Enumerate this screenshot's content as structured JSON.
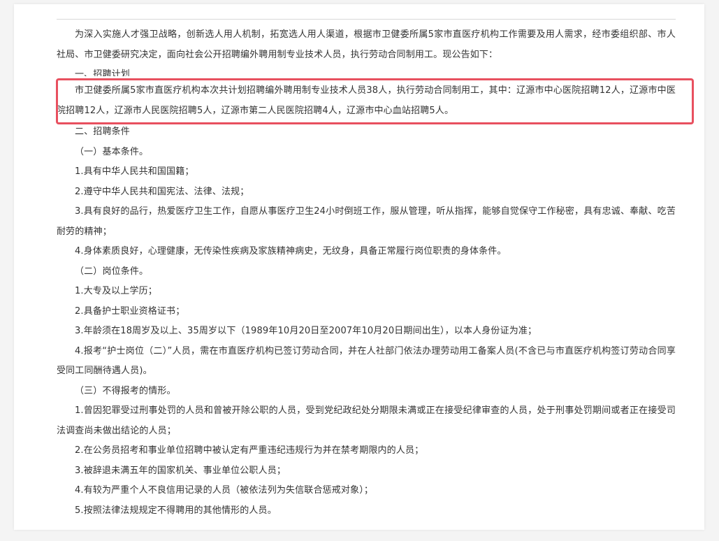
{
  "accent_color": "#e8505f",
  "article": {
    "paragraphs": [
      "为深入实施人才强卫战略，创新选人用人机制，拓宽选人用人渠道，根据市卫健委所属5家市直医疗机构工作需要及用人需求，经市委组织部、市人社局、市卫健委研究决定，面向社会公开招聘编外聘用制专业技术人员，执行劳动合同制用工。现公告如下：",
      "一、招聘计划",
      "市卫健委所属5家市直医疗机构本次共计划招聘编外聘用制专业技术人员38人，执行劳动合同制用工，其中：辽源市中心医院招聘12人，辽源市中医院招聘12人，辽源市人民医院招聘5人，辽源市第二人民医院招聘4人，辽源市中心血站招聘5人。",
      "二、招聘条件",
      "（一）基本条件。",
      "1.具有中华人民共和国国籍；",
      "2.遵守中华人民共和国宪法、法律、法规；",
      "3.具有良好的品行，热爱医疗卫生工作，自愿从事医疗卫生24小时倒班工作，服从管理，听从指挥，能够自觉保守工作秘密，具有忠诚、奉献、吃苦耐劳的精神；",
      "4.身体素质良好，心理健康，无传染性疾病及家族精神病史，无纹身，具备正常履行岗位职责的身体条件。",
      "（二）岗位条件。",
      "1.大专及以上学历；",
      "2.具备护士职业资格证书；",
      "3.年龄须在18周岁及以上、35周岁以下（1989年10月20日至2007年10月20日期间出生），以本人身份证为准；",
      "4.报考“护士岗位（二）”人员，需在市直医疗机构已签订劳动合同，并在人社部门依法办理劳动用工备案人员(不含已与市直医疗机构签订劳动合同享受同工同酬待遇人员)。",
      "（三）不得报考的情形。",
      "1.曾因犯罪受过刑事处罚的人员和曾被开除公职的人员，受到党纪政纪处分期限未满或正在接受纪律审查的人员，处于刑事处罚期间或者正在接受司法调查尚未做出结论的人员；",
      "2.在公务员招考和事业单位招聘中被认定有严重违纪违规行为并在禁考期限内的人员；",
      "3.被辞退未满五年的国家机关、事业单位公职人员；",
      "4.有较为严重个人不良信用记录的人员（被依法列为失信联合惩戒对象）；",
      "5.按照法律法规规定不得聘用的其他情形的人员。"
    ]
  }
}
